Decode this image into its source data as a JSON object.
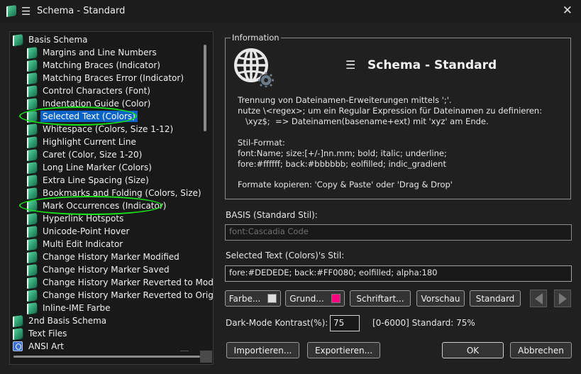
{
  "window": {
    "title": "Schema - Standard"
  },
  "tree": {
    "items": [
      {
        "label": "Basis Schema",
        "level": 0,
        "icon": "book-icon"
      },
      {
        "label": "Margins and Line Numbers",
        "level": 1,
        "icon": "book-icon"
      },
      {
        "label": "Matching Braces (Indicator)",
        "level": 1,
        "icon": "book-icon"
      },
      {
        "label": "Matching Braces Error (Indicator)",
        "level": 1,
        "icon": "book-icon"
      },
      {
        "label": "Control Characters (Font)",
        "level": 1,
        "icon": "book-icon"
      },
      {
        "label": "Indentation Guide (Color)",
        "level": 1,
        "icon": "book-icon"
      },
      {
        "label": "Selected Text (Colors)",
        "level": 1,
        "icon": "book-icon",
        "selected": true
      },
      {
        "label": "Whitespace (Colors, Size 1-12)",
        "level": 1,
        "icon": "book-icon"
      },
      {
        "label": "Highlight Current Line",
        "level": 1,
        "icon": "book-icon"
      },
      {
        "label": "Caret (Color, Size 1-20)",
        "level": 1,
        "icon": "book-icon"
      },
      {
        "label": "Long Line Marker (Colors)",
        "level": 1,
        "icon": "book-icon"
      },
      {
        "label": "Extra Line Spacing (Size)",
        "level": 1,
        "icon": "book-icon"
      },
      {
        "label": "Bookmarks and Folding (Colors, Size)",
        "level": 1,
        "icon": "book-icon"
      },
      {
        "label": "Mark Occurrences (Indicator)",
        "level": 1,
        "icon": "book-icon"
      },
      {
        "label": "Hyperlink Hotspots",
        "level": 1,
        "icon": "book-icon"
      },
      {
        "label": "Unicode-Point Hover",
        "level": 1,
        "icon": "book-icon"
      },
      {
        "label": "Multi Edit Indicator",
        "level": 1,
        "icon": "book-icon"
      },
      {
        "label": "Change History Marker Modified",
        "level": 1,
        "icon": "book-icon"
      },
      {
        "label": "Change History Marker Saved",
        "level": 1,
        "icon": "book-icon"
      },
      {
        "label": "Change History Marker Reverted to Modifi",
        "level": 1,
        "icon": "book-icon"
      },
      {
        "label": "Change History Marker Reverted to Origin",
        "level": 1,
        "icon": "book-icon"
      },
      {
        "label": "Inline-IME Farbe",
        "level": 1,
        "icon": "book-icon"
      },
      {
        "label": "2nd Basis Schema",
        "level": 0,
        "icon": "book-icon"
      },
      {
        "label": "Text Files",
        "level": 0,
        "icon": "book-icon"
      },
      {
        "label": "ANSI Art",
        "level": 0,
        "icon": "ansi-icon"
      }
    ]
  },
  "info": {
    "legend": "Information",
    "title": "Schema - Standard",
    "lines": [
      "Trennung von Dateinamen-Erweiterungen mittels ';'.",
      "nutze \\<regex>; um ein Regular Expression für Dateinamen zu definieren:",
      "   \\xyz$;  => Dateinamen(basename+ext) mit 'xyz' am Ende.",
      "Stil-Format:",
      "font:Name; size:[+/-]nn.mm; bold; italic; underline;",
      "fore:#ffffff; back:#bbbbbb; eolfilled; indic_gradient",
      "Formate kopieren: 'Copy & Paste' oder 'Drag & Drop'"
    ]
  },
  "basis": {
    "label": "BASIS (Standard Stil):",
    "value": "font:Cascadia Code"
  },
  "style": {
    "label": "Selected Text (Colors)'s Stil:",
    "value": "fore:#DEDEDE; back:#FF0080; eolfilled; alpha:180"
  },
  "buttons": {
    "farbe": "Farbe...",
    "grund": "Grund...",
    "schriftart": "Schriftart...",
    "vorschau": "Vorschau",
    "standard": "Standard",
    "importieren": "Importieren...",
    "exportieren": "Exportieren...",
    "ok": "OK",
    "abbrechen": "Abbrechen"
  },
  "colors": {
    "fore_swatch": "#DEDEDE",
    "back_swatch": "#FF0080",
    "highlight_ellipse": "#18e01a",
    "selection": "#0a64c8"
  },
  "kontrast": {
    "label": "Dark-Mode Kontrast(%):",
    "value": "75",
    "hint": "[0-6000] Standard: 75%"
  }
}
